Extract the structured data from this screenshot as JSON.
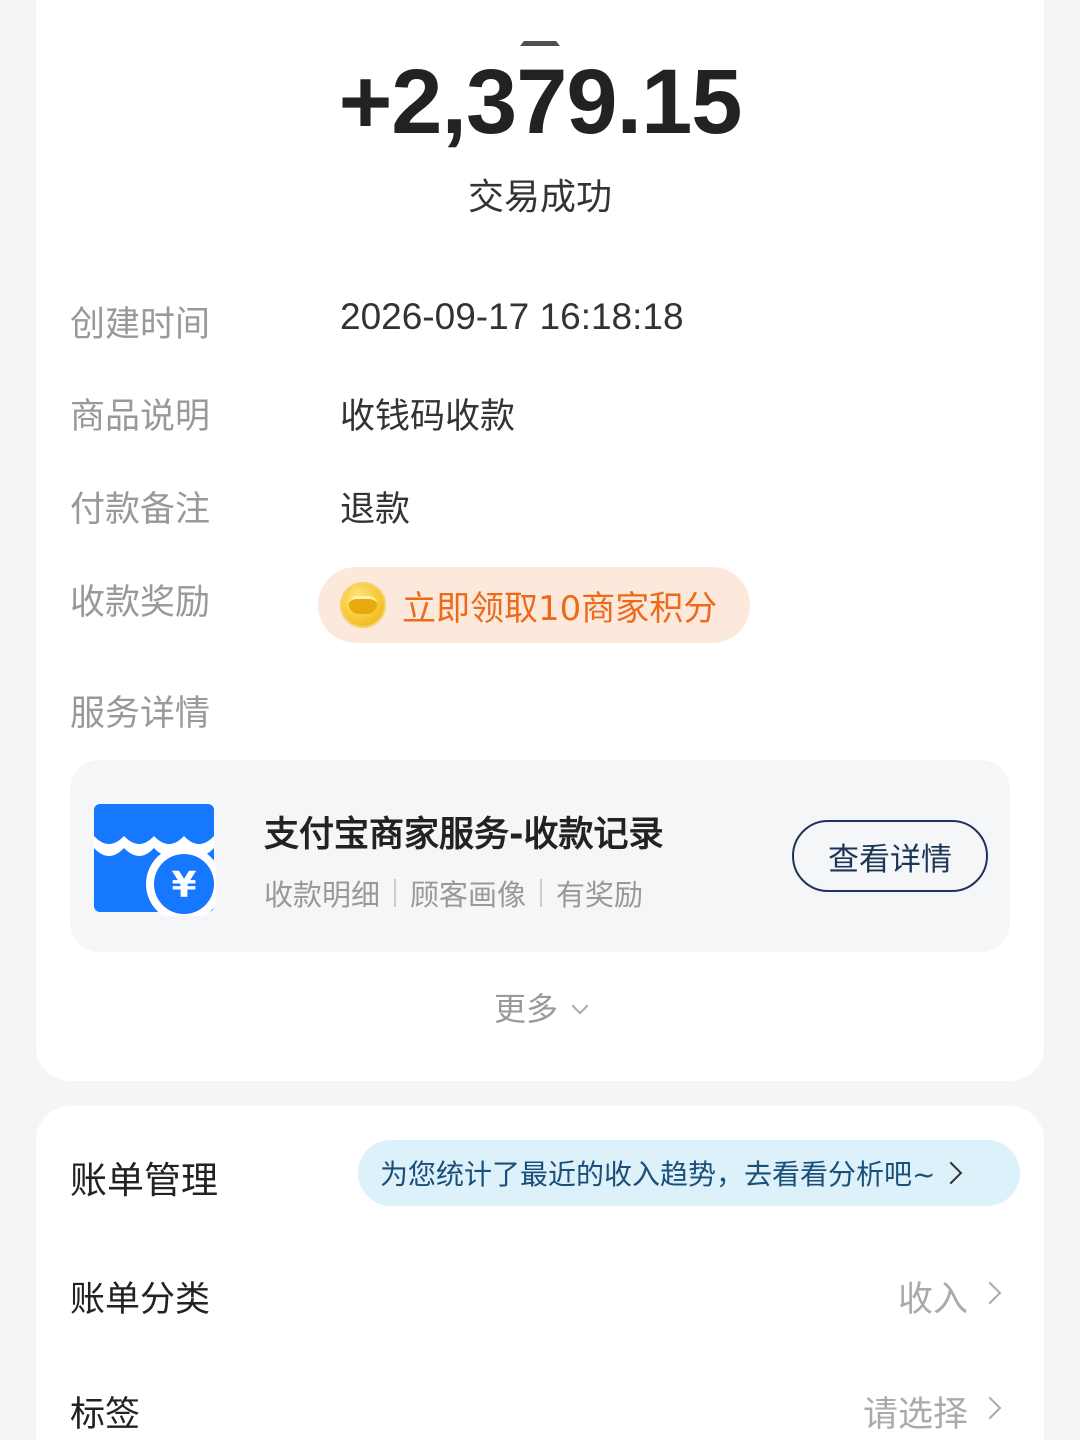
{
  "transaction": {
    "amount": "+2,379.15",
    "status": "交易成功"
  },
  "details": {
    "created_label": "创建时间",
    "created_value": "2026-09-17 16:18:18",
    "product_label": "商品说明",
    "product_value": "收钱码收款",
    "remark_label": "付款备注",
    "remark_value": "退款",
    "reward_label": "收款奖励",
    "reward_text": "立即领取10商家积分",
    "service_label": "服务详情"
  },
  "service": {
    "title": "支付宝商家服务-收款记录",
    "sub_items": [
      "收款明细",
      "顾客画像",
      "有奖励"
    ],
    "button_label": "查看详情",
    "icon": "shop-yuan-icon"
  },
  "more_label": "更多",
  "bill": {
    "management_label": "账单管理",
    "tip_text": "为您统计了最近的收入趋势，去看看分析吧~",
    "category_label": "账单分类",
    "category_value": "收入",
    "tag_label": "标签",
    "tag_value": "请选择"
  },
  "colors": {
    "accent_orange": "#ee6a1b",
    "brand_blue": "#1677ff",
    "tip_bg": "#ddf1fb",
    "reward_bg": "#fde9dc"
  }
}
